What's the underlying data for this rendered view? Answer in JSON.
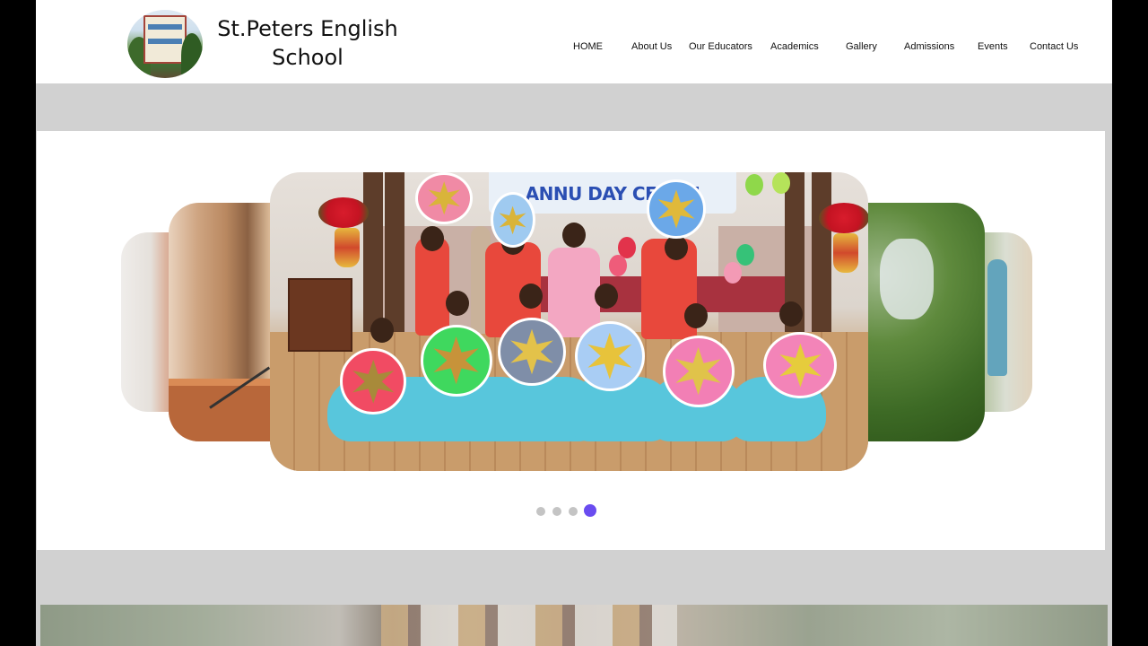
{
  "brand": {
    "name_line1": "St.Peters English",
    "name_line2": "School"
  },
  "nav": {
    "items": [
      "HOME",
      "About Us",
      "Our Educators",
      "Academics",
      "Gallery",
      "Admissions",
      "Events",
      "Contact Us"
    ]
  },
  "carousel": {
    "main_slide_banner_text": "ANNU  DAY CELE     N",
    "dot_count": 4,
    "active_index": 4
  },
  "colors": {
    "accent": "#6a4cf0",
    "dot_inactive": "#c4c4c4",
    "band_gray": "#d1d1d1"
  }
}
